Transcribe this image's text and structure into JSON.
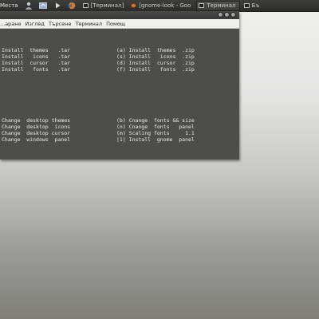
{
  "top_panel": {
    "places": "Места",
    "tasks": [
      {
        "label": "[Терминал]"
      },
      {
        "label": "[gnome-look - Goo"
      },
      {
        "label": "Терминал"
      },
      {
        "label": "Бъ"
      }
    ]
  },
  "terminal": {
    "menu": [
      "...аране",
      "Изглед",
      "Търсене",
      "Терминал",
      "Помощ"
    ],
    "lines_left": [
      "Install  themes   .tar",
      "Install   icons   .tar",
      "Install  cursor   .tar",
      "Install   fonts   .tar",
      "Change  desktop themes",
      "Change  desktop  icons",
      "Change  desktop cursor",
      "Change  windows  panel"
    ],
    "lines_right": [
      "(a) Install  themes  .zip",
      "(s) Install   icons  .zip",
      "(d) Install  cursor  .zip",
      "(f) Install   fonts  .zip",
      "(b) Cnange  fonts && size",
      "(n) Cnange  fonts   panel",
      "(m) Scaling fonts     1.1",
      "|1| Install  gnome  panel"
    ]
  },
  "colors": {
    "panel_bg": "#2f2f2d",
    "terminal_bg": "#4d4d4a",
    "terminal_text": "#ecece8"
  }
}
